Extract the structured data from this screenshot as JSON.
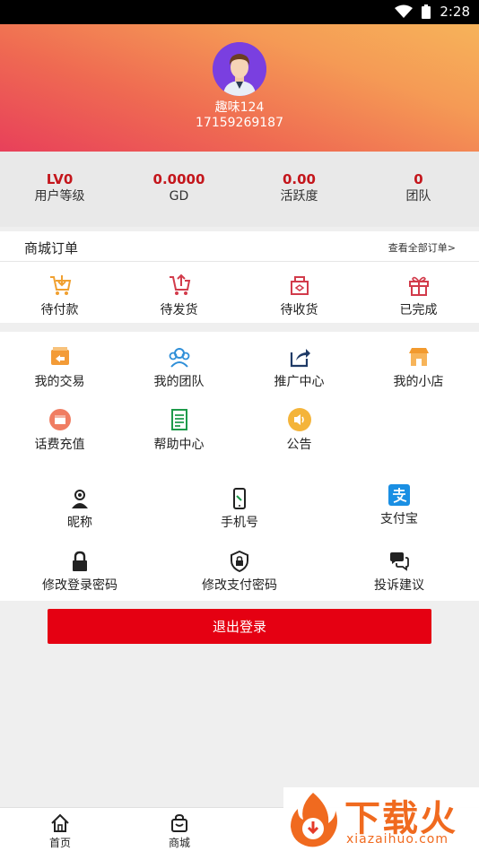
{
  "status_bar": {
    "time": "2:28",
    "wifi_icon": "wifi-icon",
    "battery_icon": "battery-icon"
  },
  "profile": {
    "name": "趣味124",
    "phone": "17159269187",
    "avatar_icon": "avatar-icon"
  },
  "stats": [
    {
      "value": "LV0",
      "label": "用户等级"
    },
    {
      "value": "0.0000",
      "label": "GD"
    },
    {
      "value": "0.00",
      "label": "活跃度"
    },
    {
      "value": "0",
      "label": "团队"
    }
  ],
  "orders": {
    "title": "商城订单",
    "view_all": "查看全部订单>",
    "items": [
      {
        "label": "待付款",
        "icon": "cart-download-icon",
        "color": "#f0a030"
      },
      {
        "label": "待发货",
        "icon": "cart-upload-icon",
        "color": "#d23b4b"
      },
      {
        "label": "待收货",
        "icon": "package-icon",
        "color": "#d23b4b"
      },
      {
        "label": "已完成",
        "icon": "gift-icon",
        "color": "#d23b4b"
      }
    ]
  },
  "menu": [
    {
      "label": "我的交易",
      "icon": "trade-icon",
      "color": "#f39b37"
    },
    {
      "label": "我的团队",
      "icon": "team-icon",
      "color": "#2f8fd8"
    },
    {
      "label": "推广中心",
      "icon": "share-icon",
      "color": "#1f3a66"
    },
    {
      "label": "我的小店",
      "icon": "shop-icon",
      "color": "#f29a2e"
    },
    {
      "label": "话费充值",
      "icon": "recharge-icon",
      "color": "#f07d62"
    },
    {
      "label": "帮助中心",
      "icon": "help-icon",
      "color": "#1d9a4a"
    },
    {
      "label": "公告",
      "icon": "announcement-icon",
      "color": "#f4b43a"
    }
  ],
  "settings": [
    {
      "label": "昵称",
      "icon": "nickname-icon"
    },
    {
      "label": "手机号",
      "icon": "phone-icon"
    },
    {
      "label": "支付宝",
      "icon": "alipay-icon",
      "color": "#1a8fe3"
    },
    {
      "label": "修改登录密码",
      "icon": "lock-icon"
    },
    {
      "label": "修改支付密码",
      "icon": "shield-lock-icon"
    },
    {
      "label": "投诉建议",
      "icon": "chat-icon"
    }
  ],
  "logout_label": "退出登录",
  "tabs": [
    {
      "label": "首页",
      "icon": "home-icon"
    },
    {
      "label": "商城",
      "icon": "bag-icon"
    }
  ],
  "watermark": {
    "title": "下载火",
    "sub": "xiazaihuo.com"
  },
  "colors": {
    "accent_red": "#e50012",
    "stat_red": "#c4161c"
  }
}
